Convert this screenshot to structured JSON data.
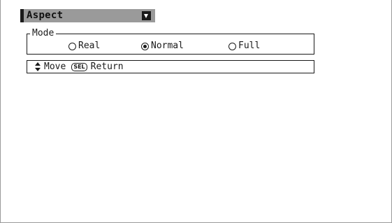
{
  "menu": {
    "title": "Aspect",
    "dropdown_icon": "dropdown-arrow-icon"
  },
  "mode_group": {
    "legend": "Mode",
    "options": [
      {
        "label": "Real",
        "selected": false
      },
      {
        "label": "Normal",
        "selected": true
      },
      {
        "label": "Full",
        "selected": false
      }
    ]
  },
  "help": {
    "move_icon": "up-down-arrows-icon",
    "move_label": "Move",
    "sel_key_label": "SEL",
    "return_label": "Return"
  },
  "colors": {
    "title_bar": "#9a9a9a",
    "accent": "#1a1a1a",
    "background": "#ffffff"
  }
}
